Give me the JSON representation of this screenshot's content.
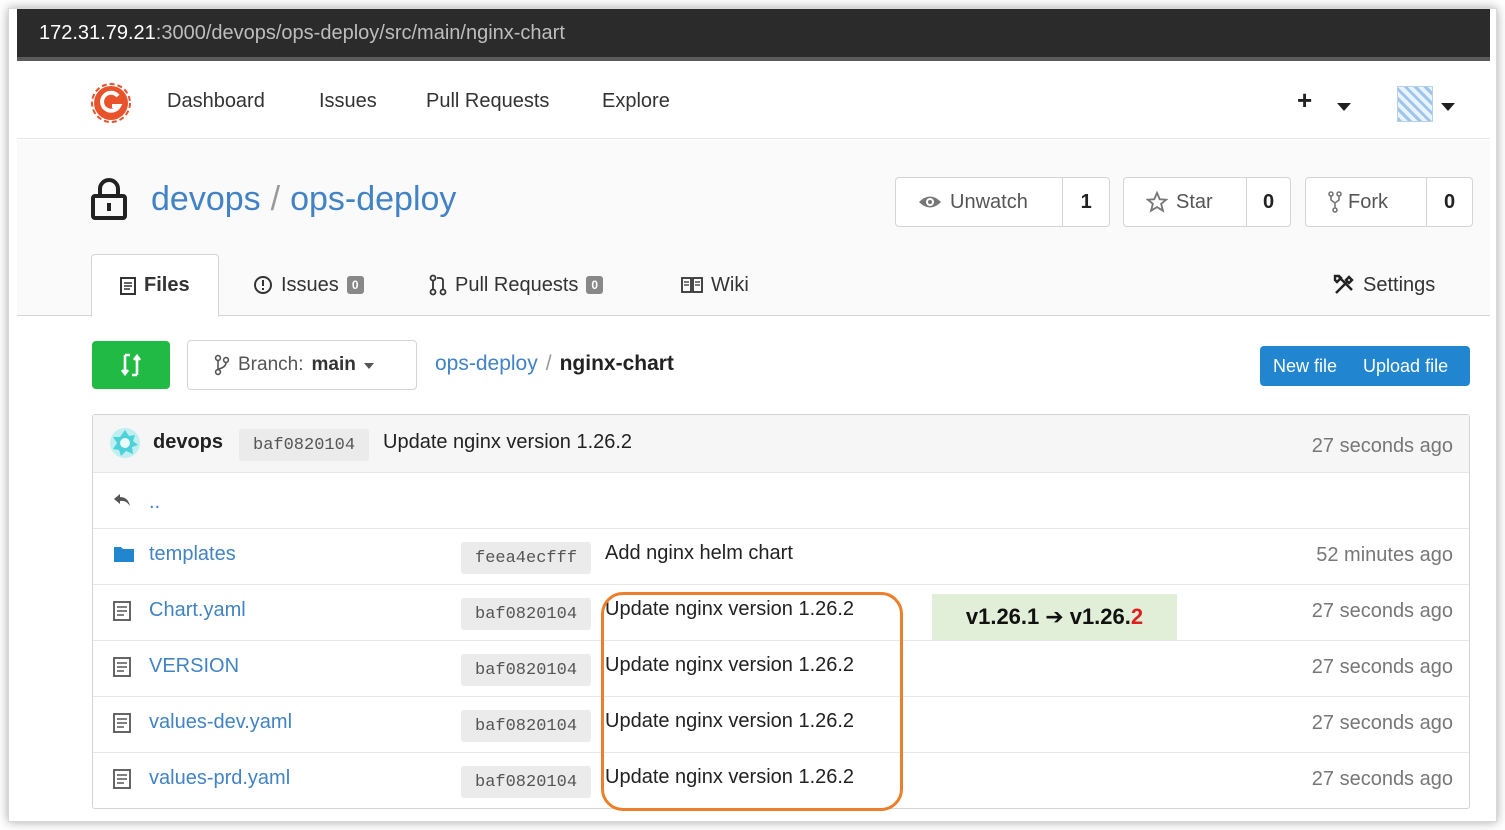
{
  "browser": {
    "url_host": "172.31.79.21",
    "url_path": ":3000/devops/ops-deploy/src/main/nginx-chart"
  },
  "nav": {
    "items": [
      "Dashboard",
      "Issues",
      "Pull Requests",
      "Explore"
    ],
    "plus": "+"
  },
  "repo": {
    "owner": "devops",
    "separator": "/",
    "name": "ops-deploy",
    "unwatch_label": "Unwatch",
    "watch_count": "1",
    "star_label": "Star",
    "star_count": "0",
    "fork_label": "Fork",
    "fork_count": "0"
  },
  "tabs": {
    "files": "Files",
    "issues": "Issues",
    "issues_count": "0",
    "pulls": "Pull Requests",
    "pulls_count": "0",
    "wiki": "Wiki",
    "settings": "Settings"
  },
  "toolbar": {
    "branch_prefix": "Branch:",
    "branch": "main",
    "crumb_root": "ops-deploy",
    "crumb_sep": "/",
    "crumb_current": "nginx-chart",
    "new_file": "New file",
    "upload_file": "Upload file"
  },
  "latest_commit": {
    "author": "devops",
    "sha": "baf0820104",
    "message": "Update nginx version 1.26.2",
    "age": "27 seconds ago"
  },
  "parent_dir": "..",
  "files": [
    {
      "name": "templates",
      "type": "folder",
      "sha": "feea4ecfff",
      "message": "Add nginx helm chart",
      "age": "52 minutes ago"
    },
    {
      "name": "Chart.yaml",
      "type": "file",
      "sha": "baf0820104",
      "message": "Update nginx version 1.26.2",
      "age": "27 seconds ago"
    },
    {
      "name": "VERSION",
      "type": "file",
      "sha": "baf0820104",
      "message": "Update nginx version 1.26.2",
      "age": "27 seconds ago"
    },
    {
      "name": "values-dev.yaml",
      "type": "file",
      "sha": "baf0820104",
      "message": "Update nginx version 1.26.2",
      "age": "27 seconds ago"
    },
    {
      "name": "values-prd.yaml",
      "type": "file",
      "sha": "baf0820104",
      "message": "Update nginx version 1.26.2",
      "age": "27 seconds ago"
    }
  ],
  "annotation": {
    "from": "v1.26.1",
    "arrow": "➔",
    "to_prefix": "v1.26.",
    "to_changed": "2"
  },
  "colors": {
    "link": "#4183c4",
    "primary": "#2185d0",
    "green": "#21ba45",
    "highlight_border": "#ec7f2b",
    "annotation_bg": "#e2efd8",
    "changed_digit": "#e02020"
  }
}
